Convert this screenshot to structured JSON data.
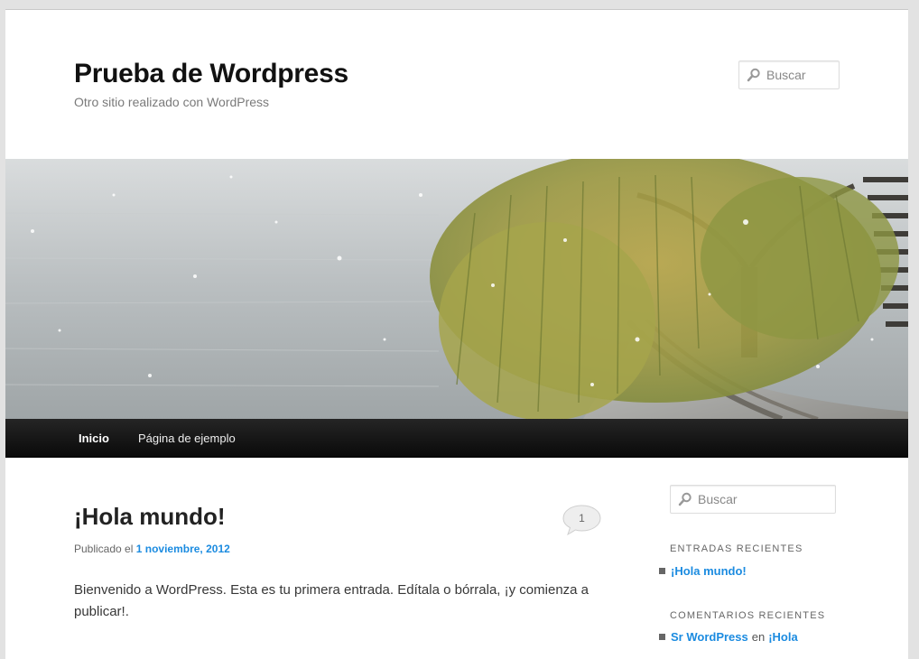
{
  "site": {
    "title": "Prueba de Wordpress",
    "description": "Otro sitio realizado con WordPress"
  },
  "header_search": {
    "placeholder": "Buscar"
  },
  "nav": {
    "items": [
      {
        "label": "Inicio",
        "current": true
      },
      {
        "label": "Página de ejemplo",
        "current": false
      }
    ]
  },
  "post": {
    "title": "¡Hola mundo!",
    "comment_count": "1",
    "meta_prefix": "Publicado el",
    "date": "1 noviembre, 2012",
    "content": "Bienvenido a WordPress. Esta es tu primera entrada. Edítala o bórrala, ¡y comienza a publicar!."
  },
  "sidebar": {
    "search": {
      "placeholder": "Buscar"
    },
    "recent_posts": {
      "title": "ENTRADAS RECIENTES",
      "items": [
        "¡Hola mundo!"
      ]
    },
    "recent_comments": {
      "title": "COMENTARIOS RECIENTES",
      "items": [
        {
          "author": "Sr WordPress",
          "connector": "en",
          "post": "¡Hola"
        }
      ]
    }
  },
  "colors": {
    "link": "#1b8be0",
    "navbar": "#111111",
    "background": "#e2e2e2"
  }
}
